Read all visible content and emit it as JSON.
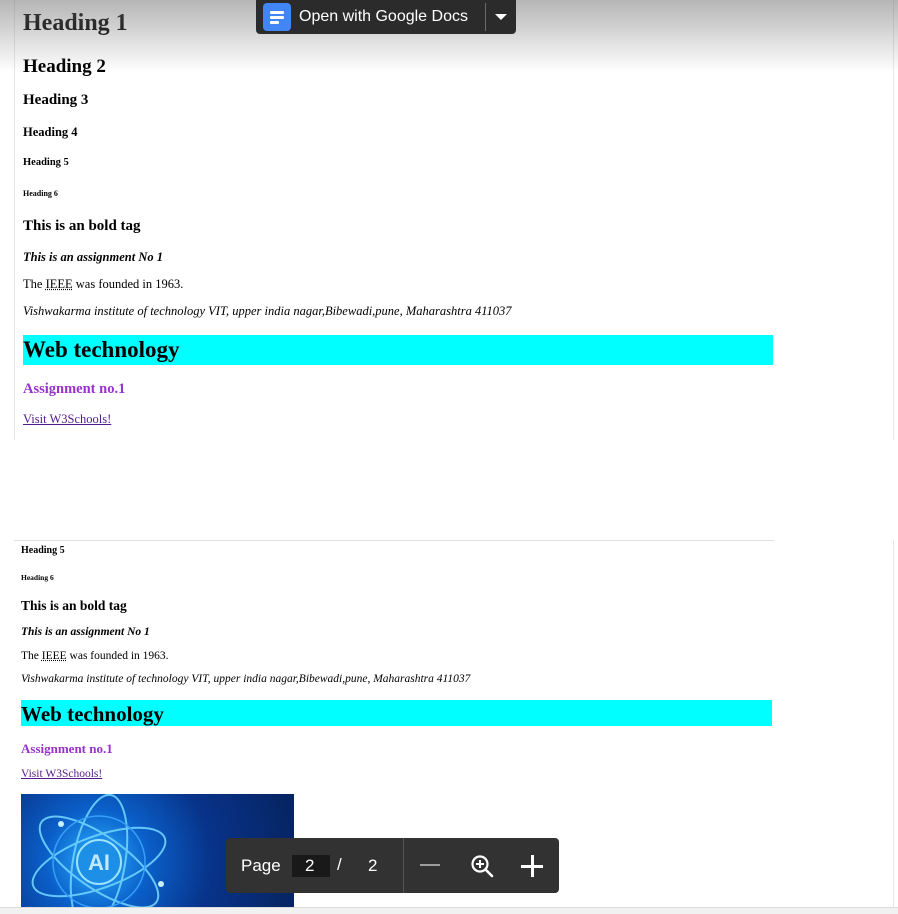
{
  "overlay": {
    "open_button_label": "Open with Google Docs",
    "docs_icon": "google-docs-icon",
    "dropdown_icon": "caret-down-icon"
  },
  "page1": {
    "h1": "Heading 1",
    "h2": "Heading 2",
    "h3": "Heading 3",
    "h4": "Heading 4",
    "h5": "Heading 5",
    "h6": "Heading 6",
    "bold": "This is an bold tag",
    "bold_italic": "This is an assignment No 1",
    "ieee_pre": "The ",
    "ieee_abbr": "IEEE",
    "ieee_post": " was founded in 1963.",
    "address": "Vishwakarma institute of technology VIT, upper india nagar,Bibewadi,pune, Maharashtra 411037",
    "banner": "Web technology",
    "assignment": "Assignment no.1",
    "link": "Visit W3Schools!"
  },
  "page2": {
    "h5": "Heading 5",
    "h6": "Heading 6",
    "bold": "This is an bold tag",
    "bold_italic": "This is an assignment No 1",
    "ieee_pre": "The ",
    "ieee_abbr": "IEEE",
    "ieee_post": " was founded in 1963.",
    "address": "Vishwakarma institute of technology VIT, upper india nagar,Bibewadi,pune, Maharashtra 411037",
    "banner": "Web technology",
    "assignment": "Assignment no.1",
    "link": "Visit W3Schools!",
    "image_text": "AI"
  },
  "toolbar": {
    "page_label": "Page",
    "current_page": "2",
    "separator": "/",
    "total_pages": "2",
    "zoom_out_icon": "minus-icon",
    "zoom_icon": "zoom-in-icon",
    "zoom_in_icon": "plus-icon"
  },
  "colors": {
    "banner_bg": "#00ffff",
    "assignment_text": "#9932cc",
    "link_text": "#551a8b",
    "toolbar_bg": "#323232",
    "docs_icon_bg": "#4285f4"
  }
}
